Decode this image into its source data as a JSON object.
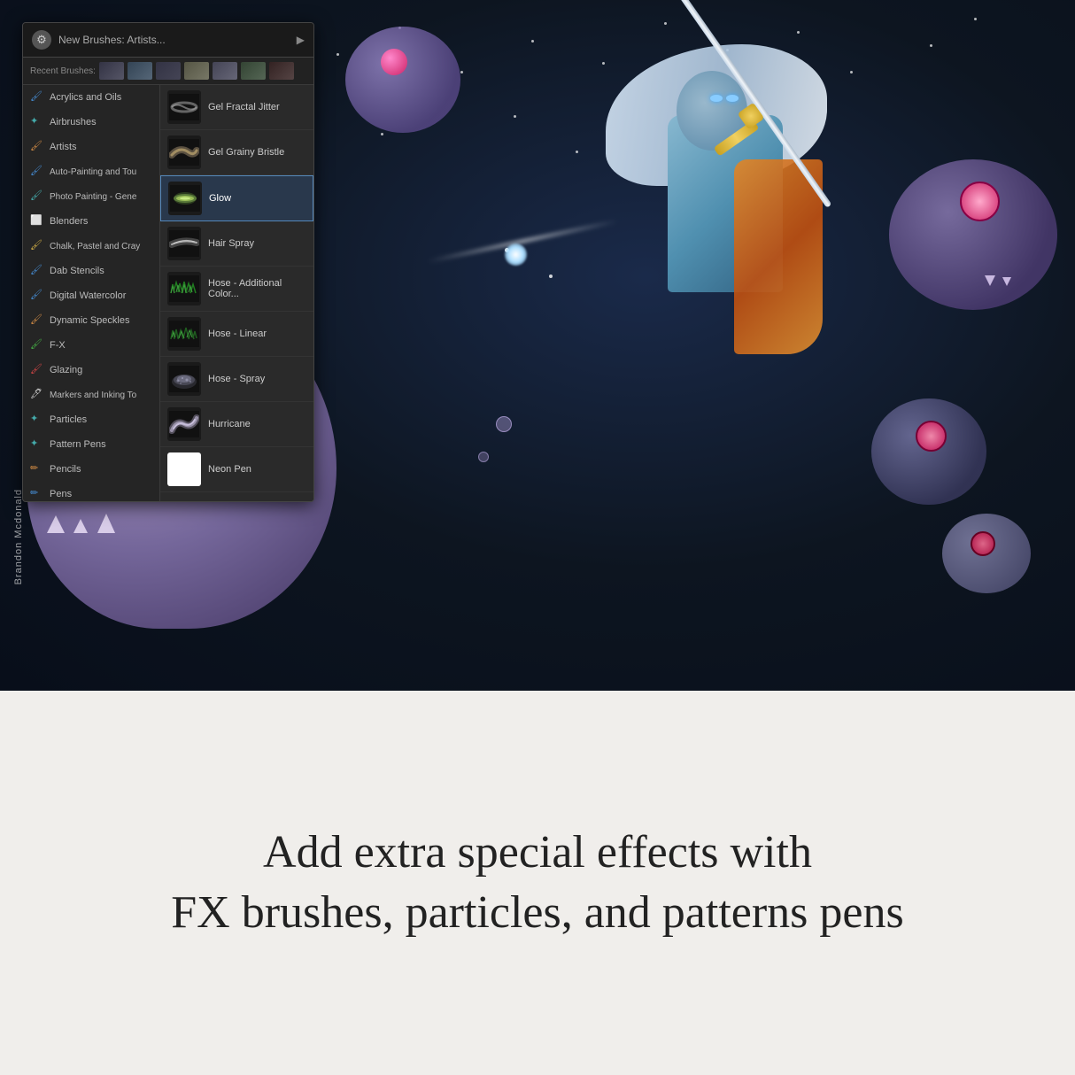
{
  "panel": {
    "title": "New Brushes: Artists...",
    "gear_symbol": "⚙",
    "arrow_symbol": "▶",
    "recent_label": "Recent Brushes:",
    "left_items": [
      {
        "label": "Acrylics and Oils",
        "icon": "🖌",
        "color": "blue"
      },
      {
        "label": "Airbrushes",
        "icon": "✦",
        "color": "teal"
      },
      {
        "label": "Artists",
        "icon": "🖌",
        "color": "orange"
      },
      {
        "label": "Auto-Painting and Tou",
        "icon": "🖌",
        "color": "blue"
      },
      {
        "label": "Photo Painting - Gene",
        "icon": "🖌",
        "color": "teal"
      },
      {
        "label": "Blenders",
        "icon": "⬜",
        "color": "white"
      },
      {
        "label": "Chalk, Pastel and Cray",
        "icon": "🖌",
        "color": "yellow"
      },
      {
        "label": "Dab Stencils",
        "icon": "🖌",
        "color": "blue"
      },
      {
        "label": "Digital Watercolor",
        "icon": "🖌",
        "color": "blue"
      },
      {
        "label": "Dynamic Speckles",
        "icon": "🖌",
        "color": "orange"
      },
      {
        "label": "F-X",
        "icon": "🖌",
        "color": "green"
      },
      {
        "label": "Glazing",
        "icon": "🖌",
        "color": "red"
      },
      {
        "label": "Markers and Inking To",
        "icon": "🖊",
        "color": "white"
      },
      {
        "label": "Particles",
        "icon": "✦",
        "color": "teal"
      },
      {
        "label": "Pattern Pens",
        "icon": "✦",
        "color": "teal"
      },
      {
        "label": "Pencils",
        "icon": "✏",
        "color": "orange"
      },
      {
        "label": "Pens",
        "icon": "✏",
        "color": "blue"
      }
    ],
    "right_items": [
      {
        "label": "Gel Fractal Jitter",
        "selected": false
      },
      {
        "label": "Gel Grainy Bristle",
        "selected": false
      },
      {
        "label": "Glow",
        "selected": true
      },
      {
        "label": "Hair Spray",
        "selected": false
      },
      {
        "label": "Hose - Additional Color...",
        "selected": false
      },
      {
        "label": "Hose - Linear",
        "selected": false
      },
      {
        "label": "Hose - Spray",
        "selected": false
      },
      {
        "label": "Hurricane",
        "selected": false
      },
      {
        "label": "Neon Pen",
        "selected": false
      }
    ]
  },
  "attribution": "Brandon Mcdonald",
  "tagline_line1": "Add extra special effects with",
  "tagline_line2": "FX brushes, particles, and patterns pens"
}
